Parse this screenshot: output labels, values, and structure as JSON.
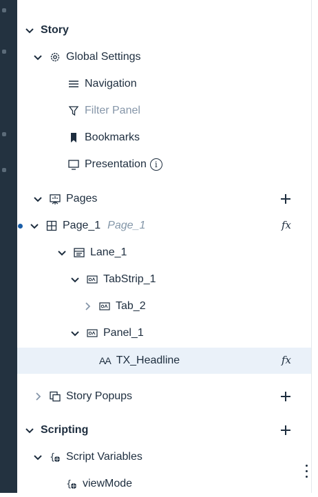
{
  "story": {
    "label": "Story",
    "global_settings": {
      "label": "Global Settings",
      "children": {
        "navigation": "Navigation",
        "filter_panel": "Filter Panel",
        "bookmarks": "Bookmarks",
        "presentation": "Presentation",
        "info_glyph": "i"
      }
    },
    "pages": {
      "label": "Pages",
      "page1": {
        "label": "Page_1",
        "subtitle": "Page_1",
        "fx": "fx",
        "lane1": {
          "label": "Lane_1",
          "tabstrip1": {
            "label": "TabStrip_1",
            "tab2": "Tab_2"
          },
          "panel1": {
            "label": "Panel_1",
            "headline": {
              "label": "TX_Headline",
              "glyph": "AA",
              "fx": "fx"
            }
          }
        }
      }
    },
    "popups": {
      "label": "Story Popups"
    }
  },
  "scripting": {
    "label": "Scripting",
    "script_variables": {
      "label": "Script Variables",
      "vars": [
        "viewMode"
      ]
    }
  },
  "colors": {
    "accent": "#1b5ea8",
    "selected_row": "#eaf1f9",
    "sidebar": "#233240"
  }
}
